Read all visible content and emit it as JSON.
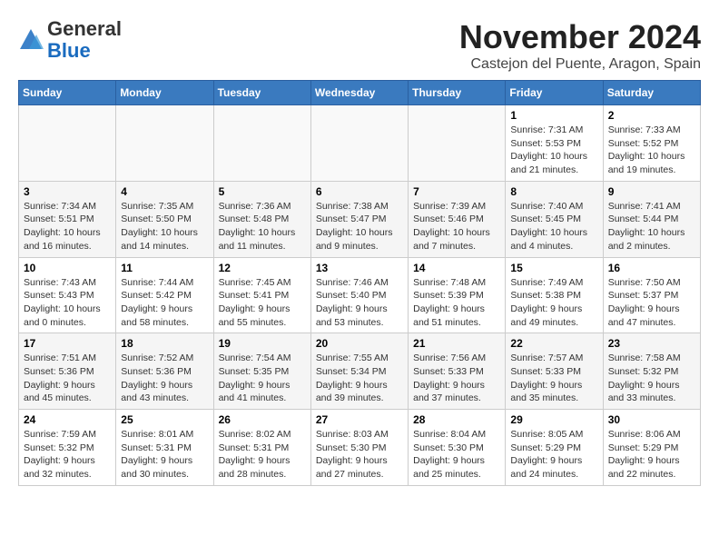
{
  "logo": {
    "general": "General",
    "blue": "Blue"
  },
  "title": "November 2024",
  "location": "Castejon del Puente, Aragon, Spain",
  "weekdays": [
    "Sunday",
    "Monday",
    "Tuesday",
    "Wednesday",
    "Thursday",
    "Friday",
    "Saturday"
  ],
  "weeks": [
    [
      {
        "day": "",
        "info": ""
      },
      {
        "day": "",
        "info": ""
      },
      {
        "day": "",
        "info": ""
      },
      {
        "day": "",
        "info": ""
      },
      {
        "day": "",
        "info": ""
      },
      {
        "day": "1",
        "info": "Sunrise: 7:31 AM\nSunset: 5:53 PM\nDaylight: 10 hours and 21 minutes."
      },
      {
        "day": "2",
        "info": "Sunrise: 7:33 AM\nSunset: 5:52 PM\nDaylight: 10 hours and 19 minutes."
      }
    ],
    [
      {
        "day": "3",
        "info": "Sunrise: 7:34 AM\nSunset: 5:51 PM\nDaylight: 10 hours and 16 minutes."
      },
      {
        "day": "4",
        "info": "Sunrise: 7:35 AM\nSunset: 5:50 PM\nDaylight: 10 hours and 14 minutes."
      },
      {
        "day": "5",
        "info": "Sunrise: 7:36 AM\nSunset: 5:48 PM\nDaylight: 10 hours and 11 minutes."
      },
      {
        "day": "6",
        "info": "Sunrise: 7:38 AM\nSunset: 5:47 PM\nDaylight: 10 hours and 9 minutes."
      },
      {
        "day": "7",
        "info": "Sunrise: 7:39 AM\nSunset: 5:46 PM\nDaylight: 10 hours and 7 minutes."
      },
      {
        "day": "8",
        "info": "Sunrise: 7:40 AM\nSunset: 5:45 PM\nDaylight: 10 hours and 4 minutes."
      },
      {
        "day": "9",
        "info": "Sunrise: 7:41 AM\nSunset: 5:44 PM\nDaylight: 10 hours and 2 minutes."
      }
    ],
    [
      {
        "day": "10",
        "info": "Sunrise: 7:43 AM\nSunset: 5:43 PM\nDaylight: 10 hours and 0 minutes."
      },
      {
        "day": "11",
        "info": "Sunrise: 7:44 AM\nSunset: 5:42 PM\nDaylight: 9 hours and 58 minutes."
      },
      {
        "day": "12",
        "info": "Sunrise: 7:45 AM\nSunset: 5:41 PM\nDaylight: 9 hours and 55 minutes."
      },
      {
        "day": "13",
        "info": "Sunrise: 7:46 AM\nSunset: 5:40 PM\nDaylight: 9 hours and 53 minutes."
      },
      {
        "day": "14",
        "info": "Sunrise: 7:48 AM\nSunset: 5:39 PM\nDaylight: 9 hours and 51 minutes."
      },
      {
        "day": "15",
        "info": "Sunrise: 7:49 AM\nSunset: 5:38 PM\nDaylight: 9 hours and 49 minutes."
      },
      {
        "day": "16",
        "info": "Sunrise: 7:50 AM\nSunset: 5:37 PM\nDaylight: 9 hours and 47 minutes."
      }
    ],
    [
      {
        "day": "17",
        "info": "Sunrise: 7:51 AM\nSunset: 5:36 PM\nDaylight: 9 hours and 45 minutes."
      },
      {
        "day": "18",
        "info": "Sunrise: 7:52 AM\nSunset: 5:36 PM\nDaylight: 9 hours and 43 minutes."
      },
      {
        "day": "19",
        "info": "Sunrise: 7:54 AM\nSunset: 5:35 PM\nDaylight: 9 hours and 41 minutes."
      },
      {
        "day": "20",
        "info": "Sunrise: 7:55 AM\nSunset: 5:34 PM\nDaylight: 9 hours and 39 minutes."
      },
      {
        "day": "21",
        "info": "Sunrise: 7:56 AM\nSunset: 5:33 PM\nDaylight: 9 hours and 37 minutes."
      },
      {
        "day": "22",
        "info": "Sunrise: 7:57 AM\nSunset: 5:33 PM\nDaylight: 9 hours and 35 minutes."
      },
      {
        "day": "23",
        "info": "Sunrise: 7:58 AM\nSunset: 5:32 PM\nDaylight: 9 hours and 33 minutes."
      }
    ],
    [
      {
        "day": "24",
        "info": "Sunrise: 7:59 AM\nSunset: 5:32 PM\nDaylight: 9 hours and 32 minutes."
      },
      {
        "day": "25",
        "info": "Sunrise: 8:01 AM\nSunset: 5:31 PM\nDaylight: 9 hours and 30 minutes."
      },
      {
        "day": "26",
        "info": "Sunrise: 8:02 AM\nSunset: 5:31 PM\nDaylight: 9 hours and 28 minutes."
      },
      {
        "day": "27",
        "info": "Sunrise: 8:03 AM\nSunset: 5:30 PM\nDaylight: 9 hours and 27 minutes."
      },
      {
        "day": "28",
        "info": "Sunrise: 8:04 AM\nSunset: 5:30 PM\nDaylight: 9 hours and 25 minutes."
      },
      {
        "day": "29",
        "info": "Sunrise: 8:05 AM\nSunset: 5:29 PM\nDaylight: 9 hours and 24 minutes."
      },
      {
        "day": "30",
        "info": "Sunrise: 8:06 AM\nSunset: 5:29 PM\nDaylight: 9 hours and 22 minutes."
      }
    ]
  ]
}
